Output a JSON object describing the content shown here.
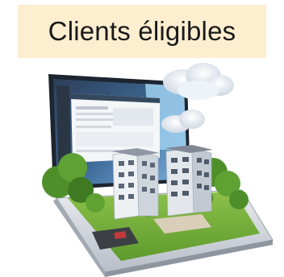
{
  "header": {
    "title": "Clients éligibles",
    "banner_color": "#fdeed0"
  },
  "illustration": {
    "icon": "laptop-with-buildings-illustration"
  }
}
